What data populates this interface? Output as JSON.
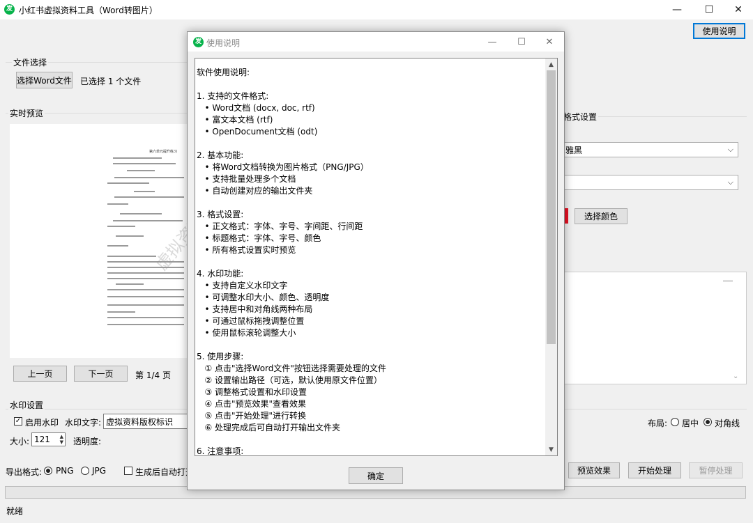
{
  "window": {
    "icon_char": "发",
    "title": "小红书虚拟资料工具（Word转图片）",
    "minimize": "—",
    "maximize": "☐",
    "close": "✕",
    "help_button": "使用说明"
  },
  "file_select": {
    "group_label": "文件选择",
    "choose_button": "选择Word文件",
    "status": "已选择 1 个文件"
  },
  "preview": {
    "group_label": "实时预览",
    "doc_heading": "第六单元提升练习",
    "watermark": "虚拟资料版权标识",
    "prev_button": "上一页",
    "next_button": "下一页",
    "page_info": "第 1/4 页"
  },
  "format_settings": {
    "group_label": "格式设置",
    "font_value": "雅黑",
    "size_value": "",
    "color_button": "选择颜色",
    "color_swatch": "#e81123"
  },
  "watermark_settings": {
    "group_label": "水印设置",
    "enable_label": "启用水印",
    "enable_checked": "✓",
    "text_label": "水印文字:",
    "text_value": "虚拟资料版权标识",
    "size_label": "大小:",
    "size_value": "121",
    "opacity_label": "透明度:",
    "layout_label": "布局:",
    "layout_center": "居中",
    "layout_diagonal": "对角线"
  },
  "export": {
    "format_label": "导出格式:",
    "png": "PNG",
    "jpg": "JPG",
    "auto_open_label": "生成后自动打开",
    "preview_button": "预览效果",
    "start_button": "开始处理",
    "pause_button": "暂停处理"
  },
  "status": {
    "text": "就绪"
  },
  "dialog": {
    "icon_char": "发",
    "title": "使用说明",
    "minimize": "—",
    "maximize": "☐",
    "close": "✕",
    "ok_button": "确定",
    "lines": [
      "软件使用说明:",
      "",
      "1. 支持的文件格式:",
      "   • Word文档 (docx, doc, rtf)",
      "   • 富文本文档 (rtf)",
      "   • OpenDocument文档 (odt)",
      "",
      "2. 基本功能:",
      "   • 将Word文档转换为图片格式（PNG/JPG）",
      "   • 支持批量处理多个文档",
      "   • 自动创建对应的输出文件夹",
      "",
      "3. 格式设置:",
      "   • 正文格式：字体、字号、字间距、行间距",
      "   • 标题格式：字体、字号、颜色",
      "   • 所有格式设置实时预览",
      "",
      "4. 水印功能:",
      "   • 支持自定义水印文字",
      "   • 可调整水印大小、颜色、透明度",
      "   • 支持居中和对角线两种布局",
      "   • 可通过鼠标拖拽调整位置",
      "   • 使用鼠标滚轮调整大小",
      "",
      "5. 使用步骤:",
      "   ① 点击\"选择Word文件\"按钮选择需要处理的文件",
      "   ② 设置输出路径（可选，默认使用原文件位置）",
      "   ③ 调整格式设置和水印设置",
      "   ④ 点击\"预览效果\"查看效果",
      "   ⑤ 点击\"开始处理\"进行转换",
      "   ⑥ 处理完成后可自动打开输出文件夹",
      "",
      "6. 注意事项:"
    ]
  }
}
